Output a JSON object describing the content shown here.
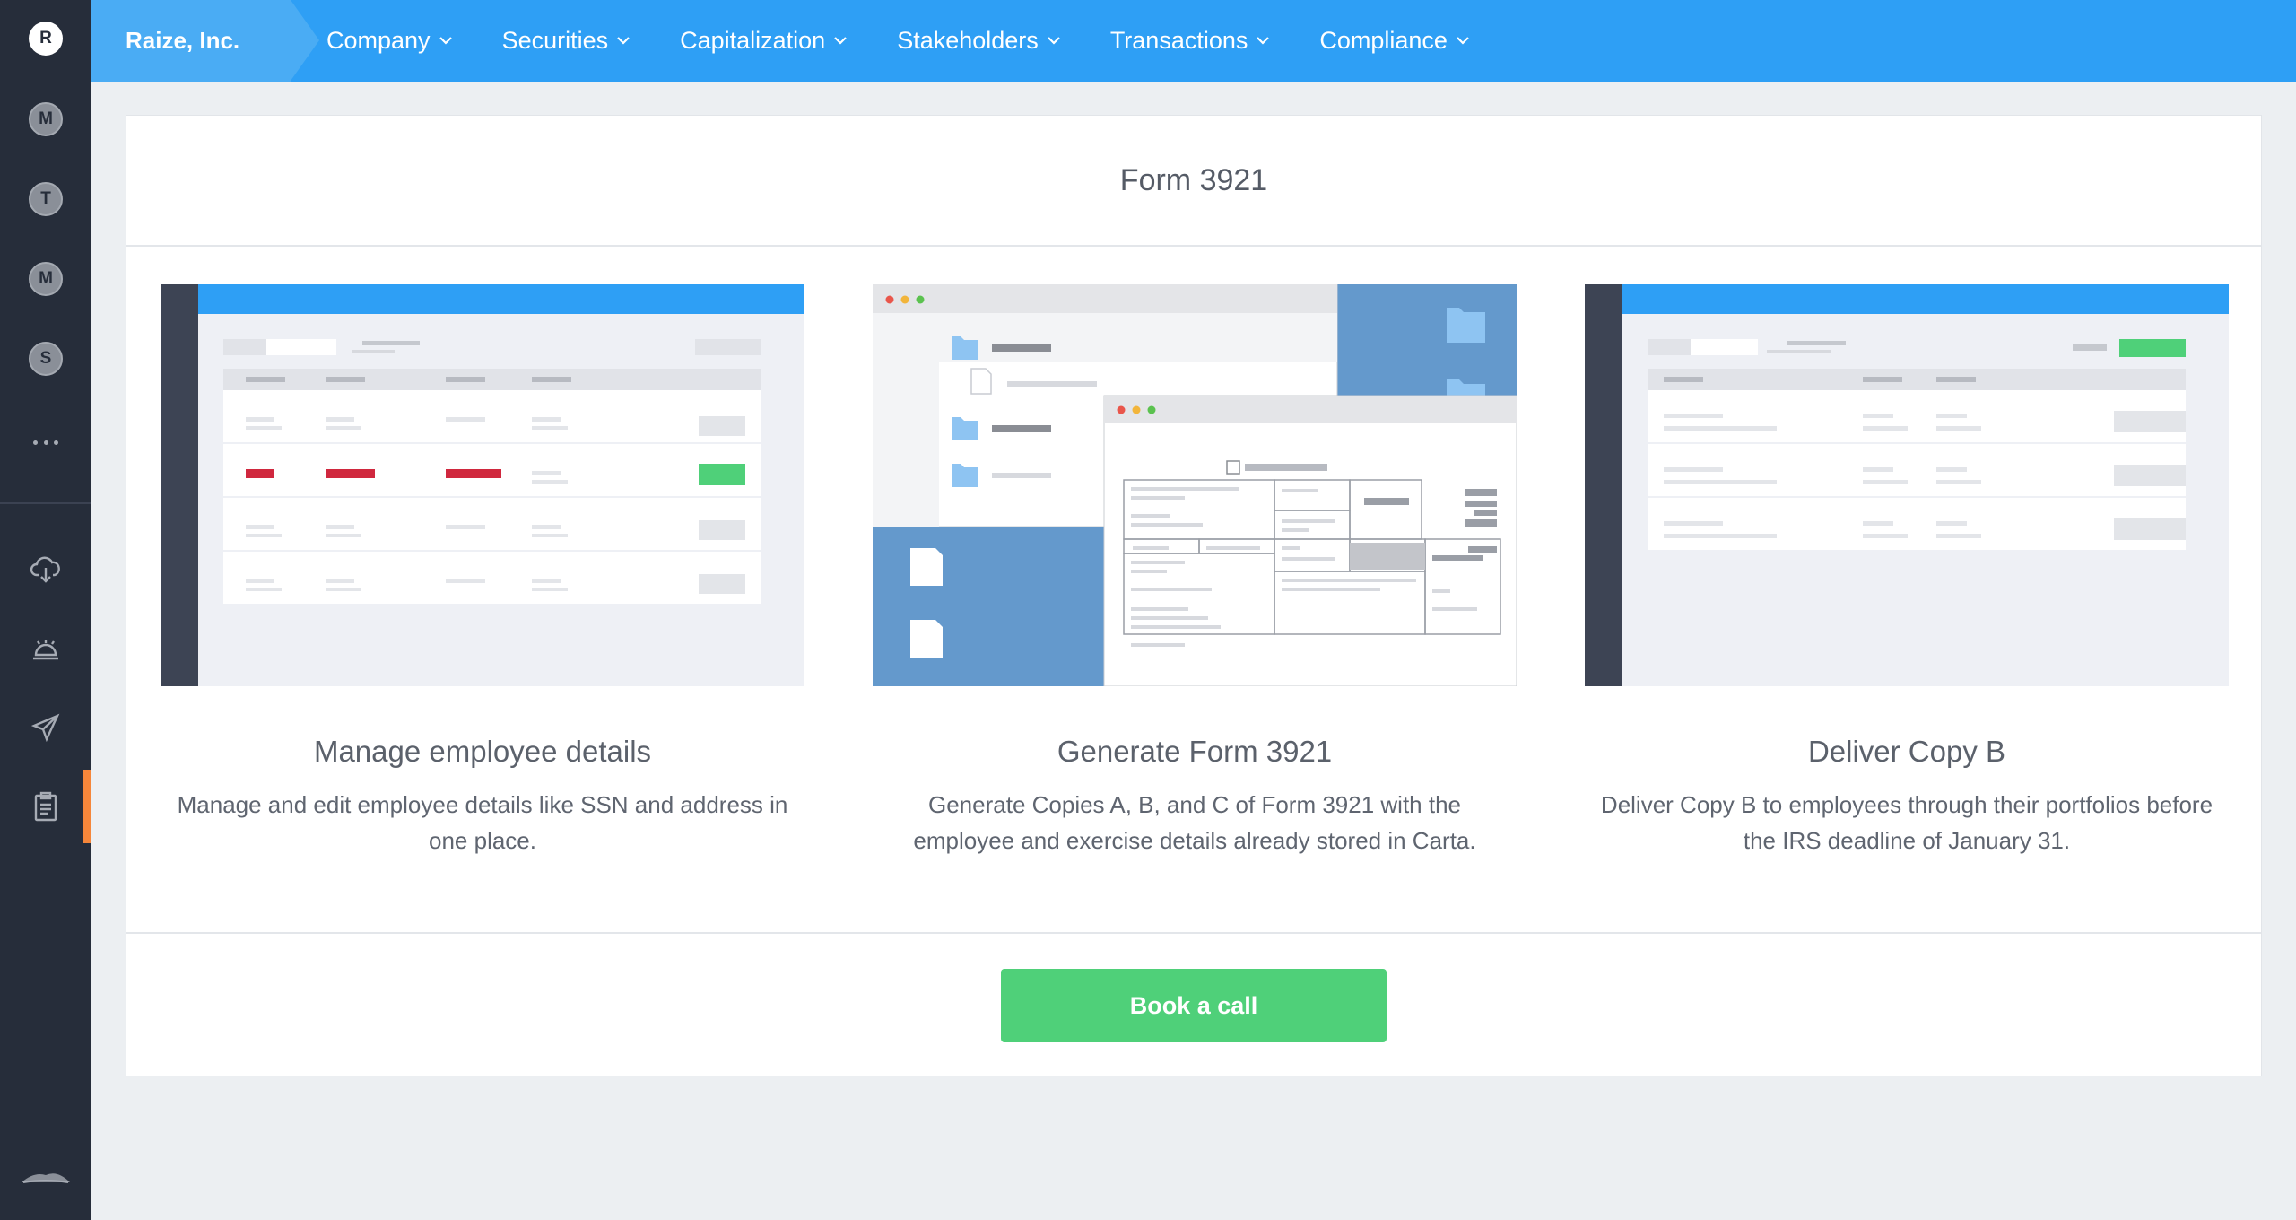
{
  "rail": {
    "org_initial": "R",
    "avatars": [
      "M",
      "T",
      "M",
      "S"
    ]
  },
  "topnav": {
    "company": "Raize, Inc.",
    "menu": [
      "Company",
      "Securities",
      "Capitalization",
      "Stakeholders",
      "Transactions",
      "Compliance"
    ]
  },
  "page": {
    "title": "Form 3921",
    "features": [
      {
        "heading": "Manage employee details",
        "text": "Manage and edit employee details like SSN and address in one place."
      },
      {
        "heading": "Generate Form 3921",
        "text": "Generate Copies A, B, and C of Form 3921 with the employee and exercise details already stored in Carta."
      },
      {
        "heading": "Deliver Copy B",
        "text": "Deliver Copy B to employees through their portfolios before the IRS deadline of January 31."
      }
    ],
    "cta": "Book a call"
  },
  "colors": {
    "nav_blue": "#2e9ff5",
    "rail_dark": "#262d3a",
    "active_orange": "#f5863a",
    "cta_green": "#4fd079",
    "error_red": "#d0283e"
  },
  "icons": [
    "cloud-download-icon",
    "bell-icon",
    "paper-plane-icon",
    "clipboard-icon",
    "carta-logo-icon",
    "chevron-down-icon"
  ]
}
